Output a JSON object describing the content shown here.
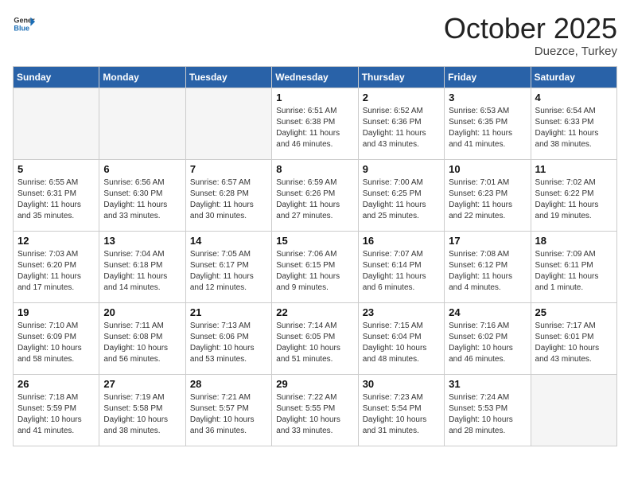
{
  "header": {
    "logo_general": "General",
    "logo_blue": "Blue",
    "title": "October 2025",
    "location": "Duezce, Turkey"
  },
  "calendar": {
    "days_of_week": [
      "Sunday",
      "Monday",
      "Tuesday",
      "Wednesday",
      "Thursday",
      "Friday",
      "Saturday"
    ],
    "weeks": [
      [
        {
          "day": "",
          "info": ""
        },
        {
          "day": "",
          "info": ""
        },
        {
          "day": "",
          "info": ""
        },
        {
          "day": "1",
          "info": "Sunrise: 6:51 AM\nSunset: 6:38 PM\nDaylight: 11 hours\nand 46 minutes."
        },
        {
          "day": "2",
          "info": "Sunrise: 6:52 AM\nSunset: 6:36 PM\nDaylight: 11 hours\nand 43 minutes."
        },
        {
          "day": "3",
          "info": "Sunrise: 6:53 AM\nSunset: 6:35 PM\nDaylight: 11 hours\nand 41 minutes."
        },
        {
          "day": "4",
          "info": "Sunrise: 6:54 AM\nSunset: 6:33 PM\nDaylight: 11 hours\nand 38 minutes."
        }
      ],
      [
        {
          "day": "5",
          "info": "Sunrise: 6:55 AM\nSunset: 6:31 PM\nDaylight: 11 hours\nand 35 minutes."
        },
        {
          "day": "6",
          "info": "Sunrise: 6:56 AM\nSunset: 6:30 PM\nDaylight: 11 hours\nand 33 minutes."
        },
        {
          "day": "7",
          "info": "Sunrise: 6:57 AM\nSunset: 6:28 PM\nDaylight: 11 hours\nand 30 minutes."
        },
        {
          "day": "8",
          "info": "Sunrise: 6:59 AM\nSunset: 6:26 PM\nDaylight: 11 hours\nand 27 minutes."
        },
        {
          "day": "9",
          "info": "Sunrise: 7:00 AM\nSunset: 6:25 PM\nDaylight: 11 hours\nand 25 minutes."
        },
        {
          "day": "10",
          "info": "Sunrise: 7:01 AM\nSunset: 6:23 PM\nDaylight: 11 hours\nand 22 minutes."
        },
        {
          "day": "11",
          "info": "Sunrise: 7:02 AM\nSunset: 6:22 PM\nDaylight: 11 hours\nand 19 minutes."
        }
      ],
      [
        {
          "day": "12",
          "info": "Sunrise: 7:03 AM\nSunset: 6:20 PM\nDaylight: 11 hours\nand 17 minutes."
        },
        {
          "day": "13",
          "info": "Sunrise: 7:04 AM\nSunset: 6:18 PM\nDaylight: 11 hours\nand 14 minutes."
        },
        {
          "day": "14",
          "info": "Sunrise: 7:05 AM\nSunset: 6:17 PM\nDaylight: 11 hours\nand 12 minutes."
        },
        {
          "day": "15",
          "info": "Sunrise: 7:06 AM\nSunset: 6:15 PM\nDaylight: 11 hours\nand 9 minutes."
        },
        {
          "day": "16",
          "info": "Sunrise: 7:07 AM\nSunset: 6:14 PM\nDaylight: 11 hours\nand 6 minutes."
        },
        {
          "day": "17",
          "info": "Sunrise: 7:08 AM\nSunset: 6:12 PM\nDaylight: 11 hours\nand 4 minutes."
        },
        {
          "day": "18",
          "info": "Sunrise: 7:09 AM\nSunset: 6:11 PM\nDaylight: 11 hours\nand 1 minute."
        }
      ],
      [
        {
          "day": "19",
          "info": "Sunrise: 7:10 AM\nSunset: 6:09 PM\nDaylight: 10 hours\nand 58 minutes."
        },
        {
          "day": "20",
          "info": "Sunrise: 7:11 AM\nSunset: 6:08 PM\nDaylight: 10 hours\nand 56 minutes."
        },
        {
          "day": "21",
          "info": "Sunrise: 7:13 AM\nSunset: 6:06 PM\nDaylight: 10 hours\nand 53 minutes."
        },
        {
          "day": "22",
          "info": "Sunrise: 7:14 AM\nSunset: 6:05 PM\nDaylight: 10 hours\nand 51 minutes."
        },
        {
          "day": "23",
          "info": "Sunrise: 7:15 AM\nSunset: 6:04 PM\nDaylight: 10 hours\nand 48 minutes."
        },
        {
          "day": "24",
          "info": "Sunrise: 7:16 AM\nSunset: 6:02 PM\nDaylight: 10 hours\nand 46 minutes."
        },
        {
          "day": "25",
          "info": "Sunrise: 7:17 AM\nSunset: 6:01 PM\nDaylight: 10 hours\nand 43 minutes."
        }
      ],
      [
        {
          "day": "26",
          "info": "Sunrise: 7:18 AM\nSunset: 5:59 PM\nDaylight: 10 hours\nand 41 minutes."
        },
        {
          "day": "27",
          "info": "Sunrise: 7:19 AM\nSunset: 5:58 PM\nDaylight: 10 hours\nand 38 minutes."
        },
        {
          "day": "28",
          "info": "Sunrise: 7:21 AM\nSunset: 5:57 PM\nDaylight: 10 hours\nand 36 minutes."
        },
        {
          "day": "29",
          "info": "Sunrise: 7:22 AM\nSunset: 5:55 PM\nDaylight: 10 hours\nand 33 minutes."
        },
        {
          "day": "30",
          "info": "Sunrise: 7:23 AM\nSunset: 5:54 PM\nDaylight: 10 hours\nand 31 minutes."
        },
        {
          "day": "31",
          "info": "Sunrise: 7:24 AM\nSunset: 5:53 PM\nDaylight: 10 hours\nand 28 minutes."
        },
        {
          "day": "",
          "info": ""
        }
      ]
    ]
  }
}
